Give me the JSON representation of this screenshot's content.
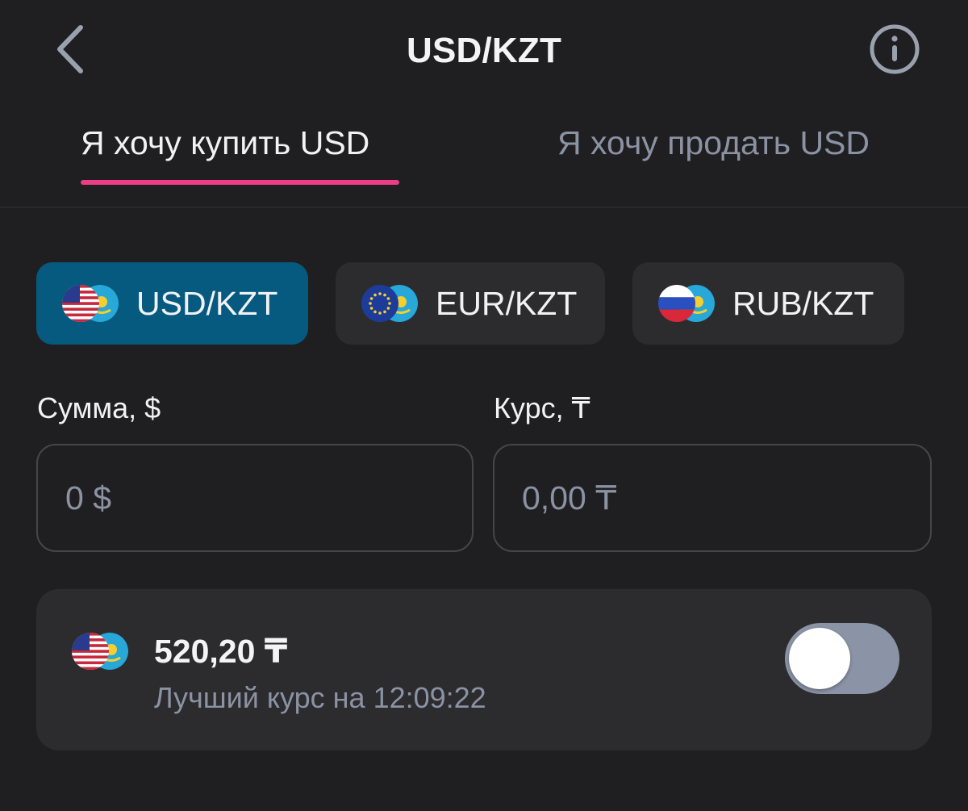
{
  "header": {
    "title": "USD/KZT",
    "back_icon": "chevron-left-icon",
    "info_icon": "info-icon"
  },
  "tabs": [
    {
      "label": "Я хочу купить USD",
      "active": true
    },
    {
      "label": "Я хочу продать USD",
      "active": false
    }
  ],
  "pairs": [
    {
      "label": "USD/KZT",
      "flag": "us-flag-icon",
      "active": true
    },
    {
      "label": "EUR/KZT",
      "flag": "eu-flag-icon",
      "active": false
    },
    {
      "label": "RUB/KZT",
      "flag": "ru-flag-icon",
      "active": false
    }
  ],
  "form": {
    "amount_label": "Сумма, $",
    "amount_placeholder": "0 $",
    "rate_label": "Курс, ₸",
    "rate_placeholder": "0,00 ₸"
  },
  "best_rate": {
    "value": "520,20 ₸",
    "caption": "Лучший курс на 12:09:22",
    "toggle_on": false
  },
  "colors": {
    "background": "#1f1f21",
    "accent_underline": "#ec3d86",
    "active_chip": "#06597f",
    "muted_text": "#8b92a3"
  }
}
